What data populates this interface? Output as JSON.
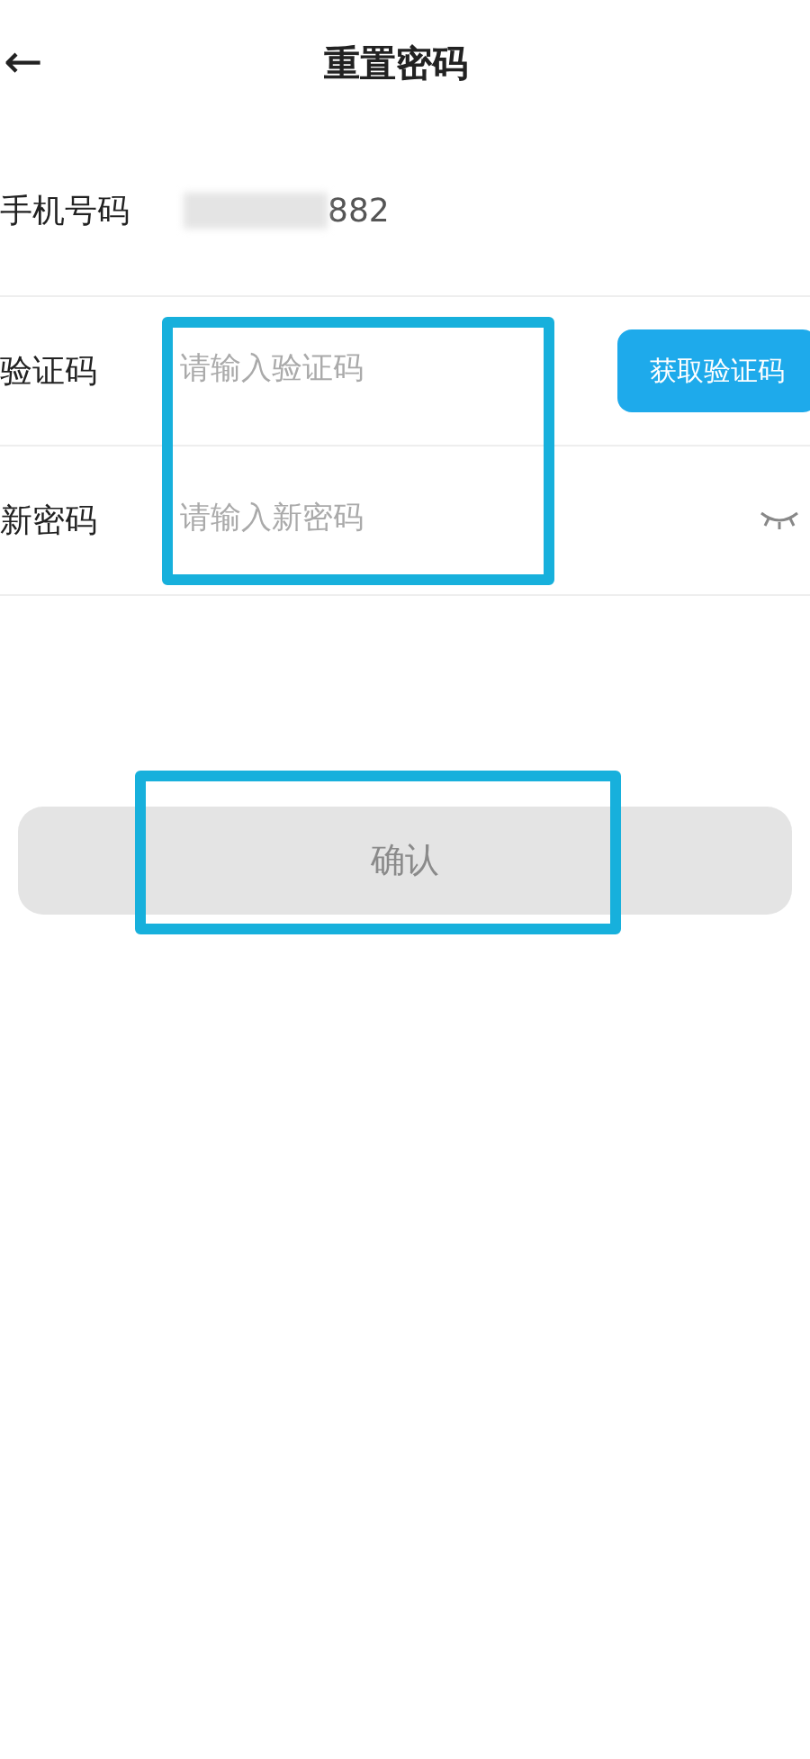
{
  "header": {
    "back": "←",
    "title": "重置密码"
  },
  "phone": {
    "label": "手机号码",
    "value": "882",
    "masked": true
  },
  "code": {
    "label": "验证码",
    "placeholder": "请输入验证码",
    "button": "获取验证码"
  },
  "password": {
    "label": "新密码",
    "placeholder": "请输入新密码",
    "visible": false
  },
  "confirm": {
    "label": "确认",
    "disabled": true
  }
}
